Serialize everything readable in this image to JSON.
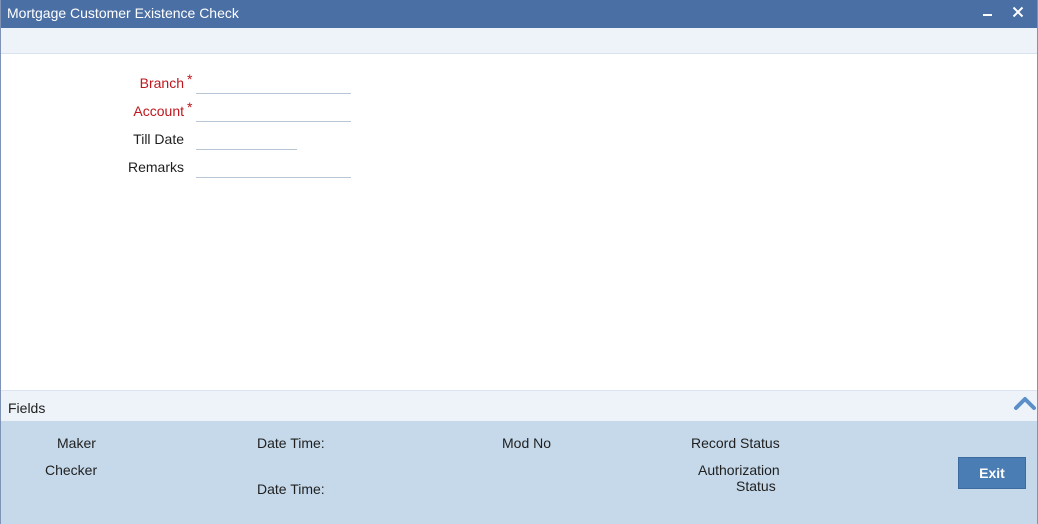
{
  "window": {
    "title": "Mortgage Customer Existence Check"
  },
  "form": {
    "branch": {
      "label": "Branch",
      "required_mark": "*",
      "value": ""
    },
    "account": {
      "label": "Account",
      "required_mark": "*",
      "value": ""
    },
    "till_date": {
      "label": "Till Date",
      "value": ""
    },
    "remarks": {
      "label": "Remarks",
      "value": ""
    }
  },
  "fields_bar": {
    "label": "Fields"
  },
  "audit": {
    "maker_label": "Maker",
    "checker_label": "Checker",
    "date_time_label_1": "Date Time:",
    "date_time_label_2": "Date Time:",
    "mod_no_label": "Mod No",
    "record_status_label": "Record Status",
    "authorization_status_line1": "Authorization",
    "authorization_status_line2": "Status"
  },
  "buttons": {
    "exit_label": "Exit"
  },
  "colors": {
    "titlebar": "#4a6fa5",
    "required_label": "#c0161c",
    "footer": "#c5d9ea",
    "exit_button": "#4a7db3"
  },
  "icons": {
    "minimize": "minimize-icon",
    "close": "close-icon",
    "collapse": "chevron-up-icon"
  }
}
